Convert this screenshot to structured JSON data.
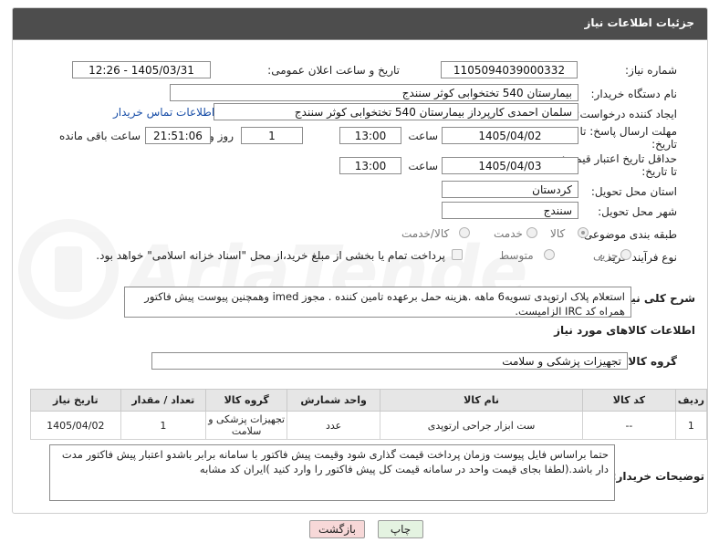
{
  "header": {
    "title": "جزئیات اطلاعات نیاز"
  },
  "fields": {
    "need_number_label": "شماره نیاز:",
    "need_number": "1105094039000332",
    "announce_label": "تاریخ و ساعت اعلان عمومی:",
    "announce_value": "1405/03/31 - 12:26",
    "buyer_org_label": "نام دستگاه خریدار:",
    "buyer_org": "بیمارستان 540 تختخوابی کوثر سنندج",
    "creator_label": "ایجاد کننده درخواست:",
    "creator": "سلمان احمدی کارپرداز بیمارستان 540 تختخوابی کوثر سنندج",
    "contact_link": "اطلاعات تماس خریدار",
    "deadline_label_1": "مهلت ارسال پاسخ: تا",
    "deadline_label_2": "تاریخ:",
    "deadline_date": "1405/04/02",
    "time_label": "ساعت",
    "deadline_time": "13:00",
    "day_label": "روز و",
    "days_value": "1",
    "remaining_value": "21:51:06",
    "remaining_label": "ساعت باقی مانده",
    "validity_label_1": "حداقل تاریخ اعتبار قیمت:",
    "validity_label_2": "تا تاریخ:",
    "validity_date": "1405/04/03",
    "validity_time": "13:00",
    "province_label": "استان محل تحویل:",
    "province": "کردستان",
    "city_label": "شهر محل تحویل:",
    "city": "سنندج",
    "category_label": "طبقه بندی موضوعی:",
    "category_options": [
      "کالا",
      "خدمت",
      "کالا/خدمت"
    ],
    "process_label": "نوع فرآیند خرید :",
    "process_options": [
      "جزیی",
      "متوسط"
    ],
    "payment_note": "پرداخت تمام یا بخشی از مبلغ خرید،از محل \"اسناد خزانه اسلامی\" خواهد بود."
  },
  "description": {
    "label": "شرح کلی نیاز:",
    "text": "استعلام پلاک  ارتوپدی تسویه6 ماهه .هزینه حمل برعهده تامین کننده . مجوز imed وهمچنین پیوست پیش فاکتور همراه کد IRC  الزامیست."
  },
  "goods_info": {
    "section_title": "اطلاعات کالاهای مورد نیاز",
    "group_label": "گروه کالا:",
    "group_value": "تجهیزات پزشکی و سلامت"
  },
  "table": {
    "headers": [
      "ردیف",
      "کد کالا",
      "نام کالا",
      "واحد شمارش",
      "گروه کالا",
      "تعداد / مقدار",
      "تاریخ نیاز"
    ],
    "rows": [
      [
        "1",
        "--",
        "ست ابزار جراحی ارتوپدی",
        "عدد",
        "تجهیزات پزشکی و سلامت",
        "1",
        "1405/04/02"
      ]
    ]
  },
  "buyer_notes": {
    "label": "توضیحات خریدار:",
    "text": "حتما براساس فایل پیوست  وزمان پرداخت قیمت گذاری شود وقیمت پیش فاکتور با سامانه برابر باشدو اعتبار پیش فاکتور مدت دار باشد.(لطفا بجای قیمت واحد در سامانه قیمت کل پیش فاکتور را وارد کنید )ایران کد مشابه"
  },
  "buttons": {
    "print": "چاپ",
    "back": "بازگشت"
  },
  "colors": {
    "header_bg": "#4d4d4d",
    "back_bg": "#f7d8d8",
    "print_bg": "#e4f3e1",
    "link": "#1a4fa8"
  }
}
